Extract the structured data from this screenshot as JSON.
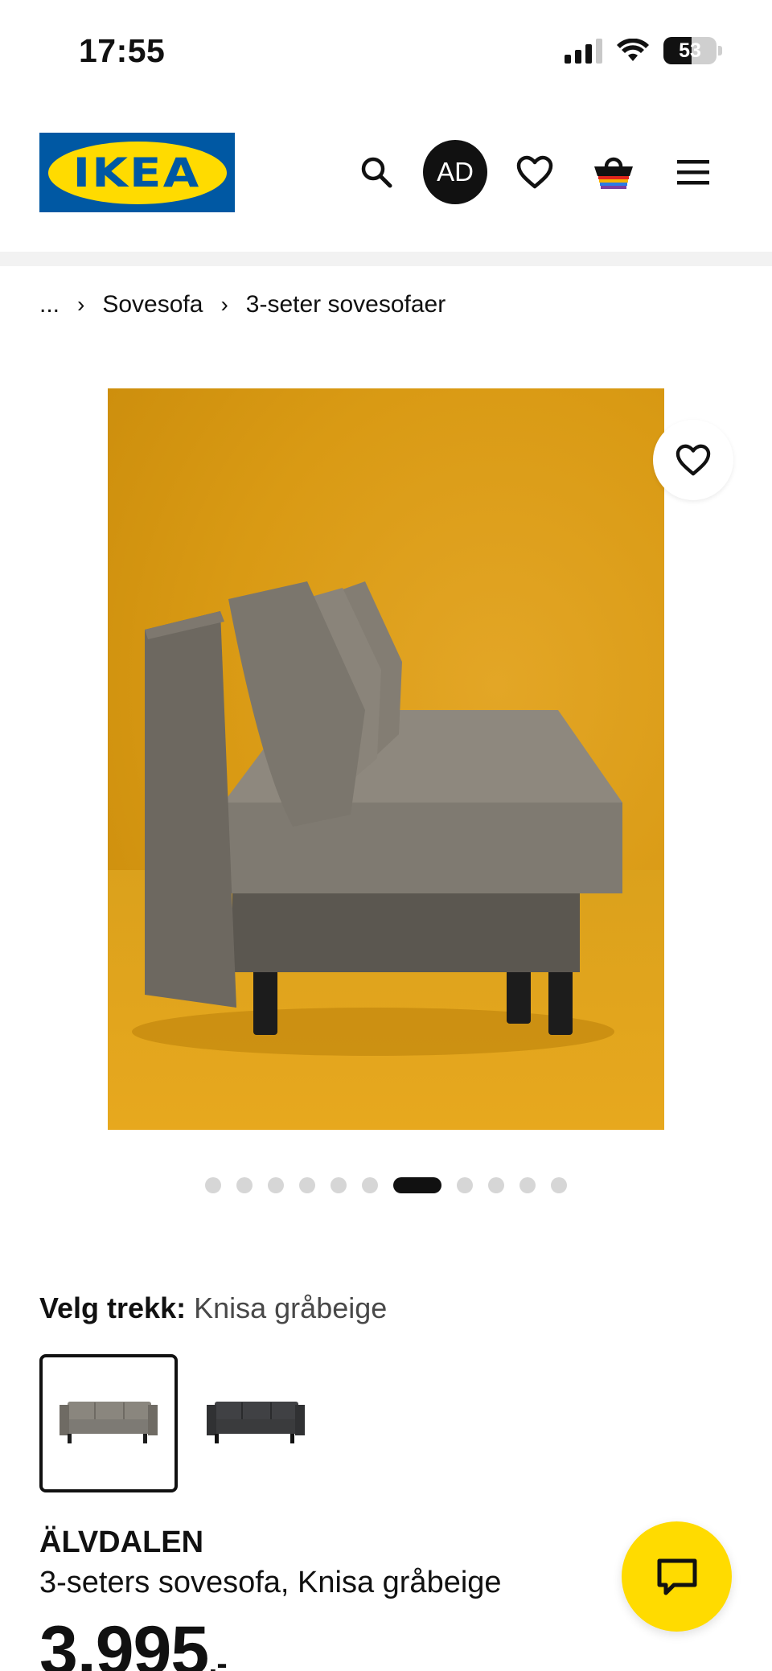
{
  "status_bar": {
    "time": "17:55",
    "battery_level": "53",
    "signal_bars": 3
  },
  "header": {
    "logo_text": "IKEA",
    "avatar_initials": "AD",
    "brand_colors": {
      "blue": "#0058a3",
      "yellow": "#ffdb00"
    },
    "icons": [
      "search-icon",
      "heart-icon",
      "basket-icon",
      "menu-icon"
    ]
  },
  "breadcrumb": [
    "...",
    "Sovesofa",
    "3-seter sovesofaer"
  ],
  "gallery": {
    "image_count": 11,
    "active_index": 6
  },
  "cover": {
    "label": "Velg trekk:",
    "selected_value": "Knisa gråbeige",
    "options": [
      {
        "name": "Knisa gråbeige",
        "color": "#7d7a74",
        "selected": true
      },
      {
        "name": "mørk grå",
        "color": "#3a3b3d",
        "selected": false
      }
    ]
  },
  "product": {
    "name": "ÄLVDALEN",
    "description": "3-seters sovesofa, Knisa gråbeige",
    "price": "3.995",
    "price_suffix": ",-"
  }
}
